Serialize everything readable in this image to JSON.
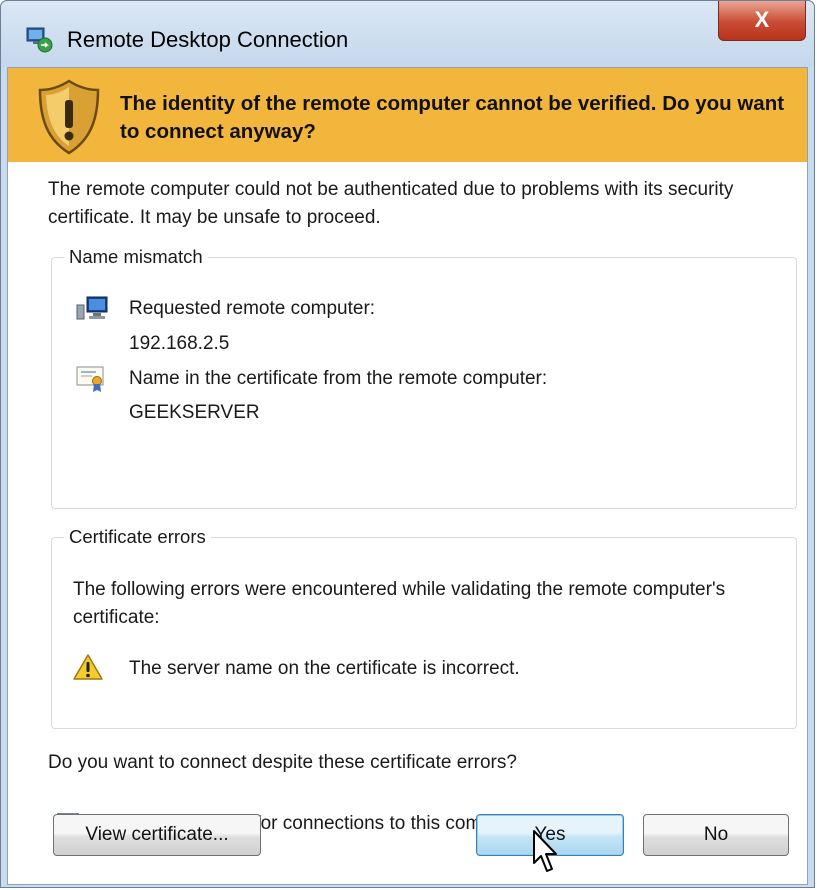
{
  "window": {
    "title": "Remote Desktop Connection",
    "close_label": "X"
  },
  "banner": {
    "message": "The identity of the remote computer cannot be verified. Do you want to connect anyway?",
    "icon": "shield-warning-icon",
    "color": "#f3b63c"
  },
  "intro_text": "The remote computer could not be authenticated due to problems with its security certificate. It may be unsafe to proceed.",
  "name_mismatch": {
    "title": "Name mismatch",
    "requested_label": "Requested remote computer:",
    "requested_value": "192.168.2.5",
    "certificate_label": "Name in the certificate from the remote computer:",
    "certificate_value": "GEEKSERVER"
  },
  "certificate_errors": {
    "title": "Certificate errors",
    "description": "The following errors were encountered while validating the remote computer's certificate:",
    "error_text": "The server name on the certificate is incorrect."
  },
  "question": "Do you want to connect despite these certificate errors?",
  "dont_ask": {
    "label": "Don't ask me again for connections to this computer",
    "checked": true,
    "check_glyph": "✓"
  },
  "buttons": {
    "view_certificate": "View certificate...",
    "yes": "Yes",
    "no": "No"
  }
}
